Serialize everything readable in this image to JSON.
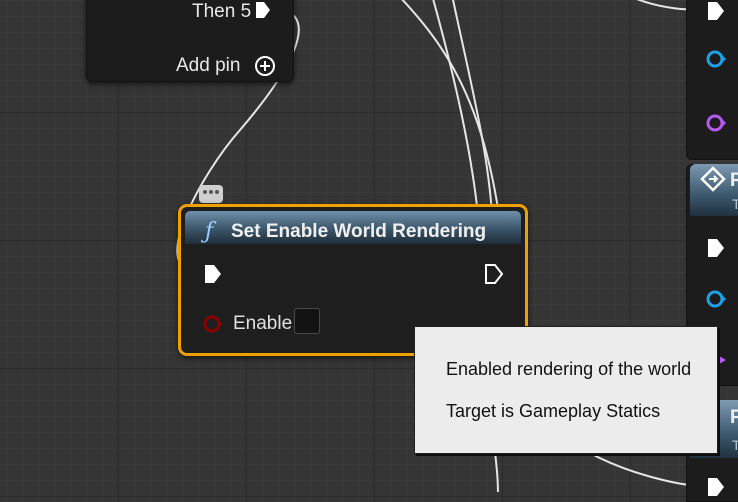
{
  "sequence_node": {
    "then_label": "Then 5",
    "add_pin_label": "Add pin"
  },
  "main_node": {
    "title": "Set Enable World Rendering",
    "func_icon": "function-icon",
    "enable_label": "Enable",
    "enable_checked": false,
    "accent_color": "#f0a000"
  },
  "right_nodes": {
    "letter_1": "P",
    "sub_1": "T",
    "letter_2": "P",
    "sub_2": "T"
  },
  "tooltip": {
    "line1": "Enabled rendering of the world",
    "line2": "Target is Gameplay Statics"
  },
  "colors": {
    "exec_pin": "#ffffff",
    "object_pin": "#1ea0e6",
    "bool_pin": "#8b0000",
    "purple_pin": "#b45af0"
  }
}
